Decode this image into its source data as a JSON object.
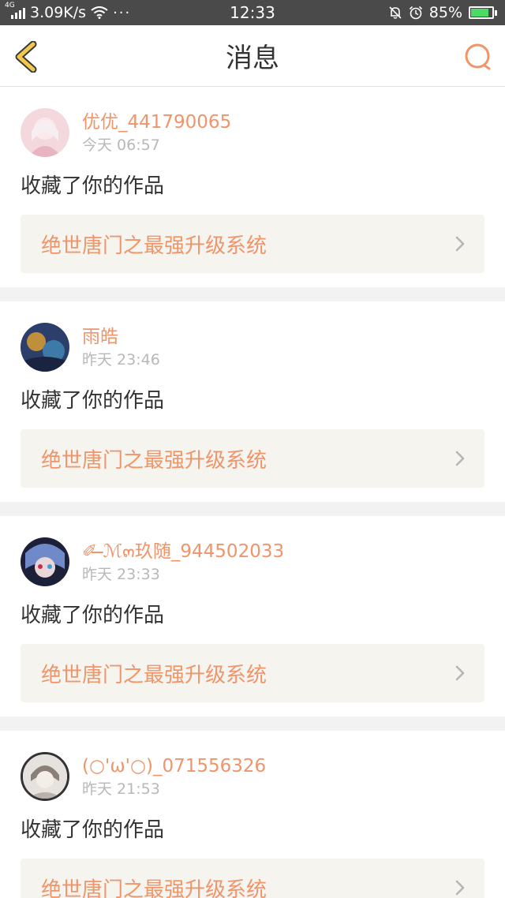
{
  "status_bar": {
    "network_label": "4G",
    "speed": "3.09K/s",
    "dots": "···",
    "time": "12:33",
    "battery_percent": "85%",
    "battery_level": 0.85
  },
  "header": {
    "title": "消息"
  },
  "messages": [
    {
      "username": "优优_441790065",
      "time": "今天 06:57",
      "action": "收藏了你的作品",
      "work_title": "绝世唐门之最强升级系统",
      "avatar_colors": [
        "#f3d9de",
        "#e8b4c0"
      ]
    },
    {
      "username": "雨皓",
      "time": "昨天 23:46",
      "action": "收藏了你的作品",
      "work_title": "绝世唐门之最强升级系统",
      "avatar_colors": [
        "#2b3f6a",
        "#c08f3c"
      ]
    },
    {
      "username": "✐ ̶̶ℳ๓玖随_944502033",
      "time": "昨天 23:33",
      "action": "收藏了你的作品",
      "work_title": "绝世唐门之最强升级系统",
      "avatar_colors": [
        "#1c2038",
        "#6f89c9"
      ]
    },
    {
      "username": "(○'ω'○)_071556326",
      "time": "昨天 21:53",
      "action": "收藏了你的作品",
      "work_title": "绝世唐门之最强升级系统",
      "avatar_colors": [
        "#e6e2de",
        "#8a8078"
      ]
    }
  ],
  "colors": {
    "accent": "#f0946a",
    "back_arrow": "#f2c94c",
    "status_bar_bg": "#4a4a4a"
  }
}
